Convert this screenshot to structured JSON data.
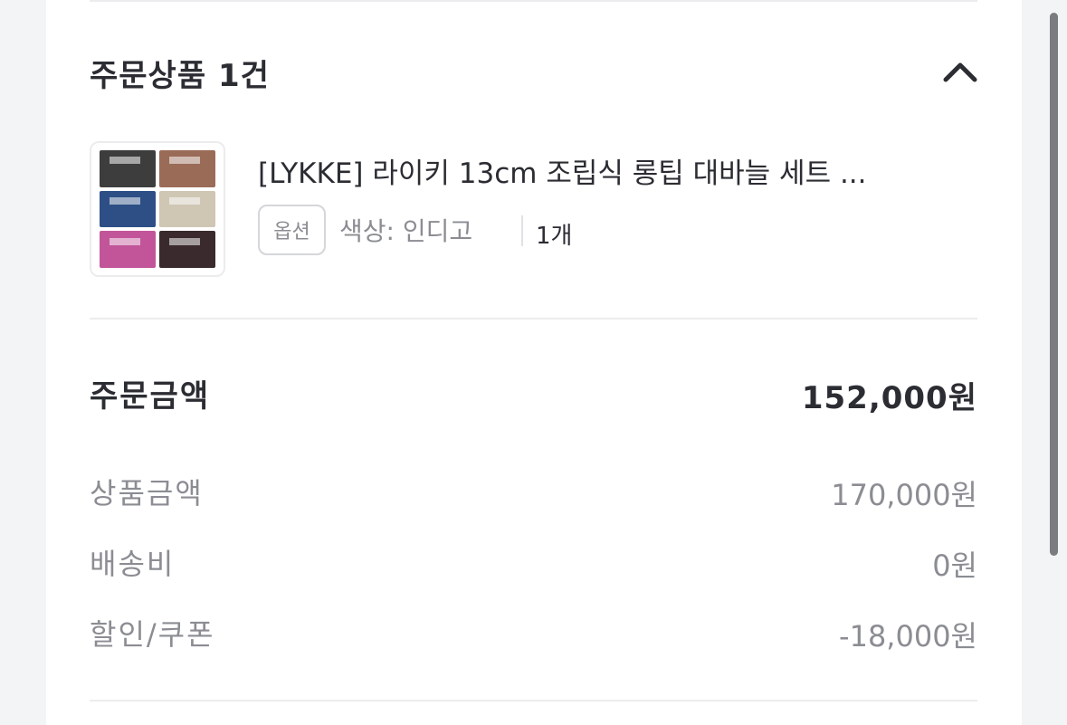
{
  "order_items": {
    "title": "주문상품 1건",
    "toggle_icon": "chevron-up-icon",
    "items": [
      {
        "name": "[LYKKE] 라이키 13cm 조립식 롱팁 대바늘 세트 ...",
        "option_badge": "옵션",
        "option_value": "색상: 인디고",
        "quantity": "1개",
        "thumbnail_colors": [
          "#3d3d3d",
          "#9a6b57",
          "#2d4f86",
          "#cfc6b4",
          "#c2559a",
          "#3a2a2d"
        ]
      }
    ]
  },
  "summary": {
    "total_label": "주문금액",
    "total_value": "152,000원",
    "rows": [
      {
        "label": "상품금액",
        "value": "170,000원"
      },
      {
        "label": "배송비",
        "value": "0원"
      },
      {
        "label": "할인/쿠폰",
        "value": "-18,000원"
      }
    ]
  },
  "colors": {
    "text_primary": "#2b2d33",
    "text_secondary": "#8b8d93",
    "divider": "#ececee",
    "page_bg": "#f3f4f6"
  }
}
